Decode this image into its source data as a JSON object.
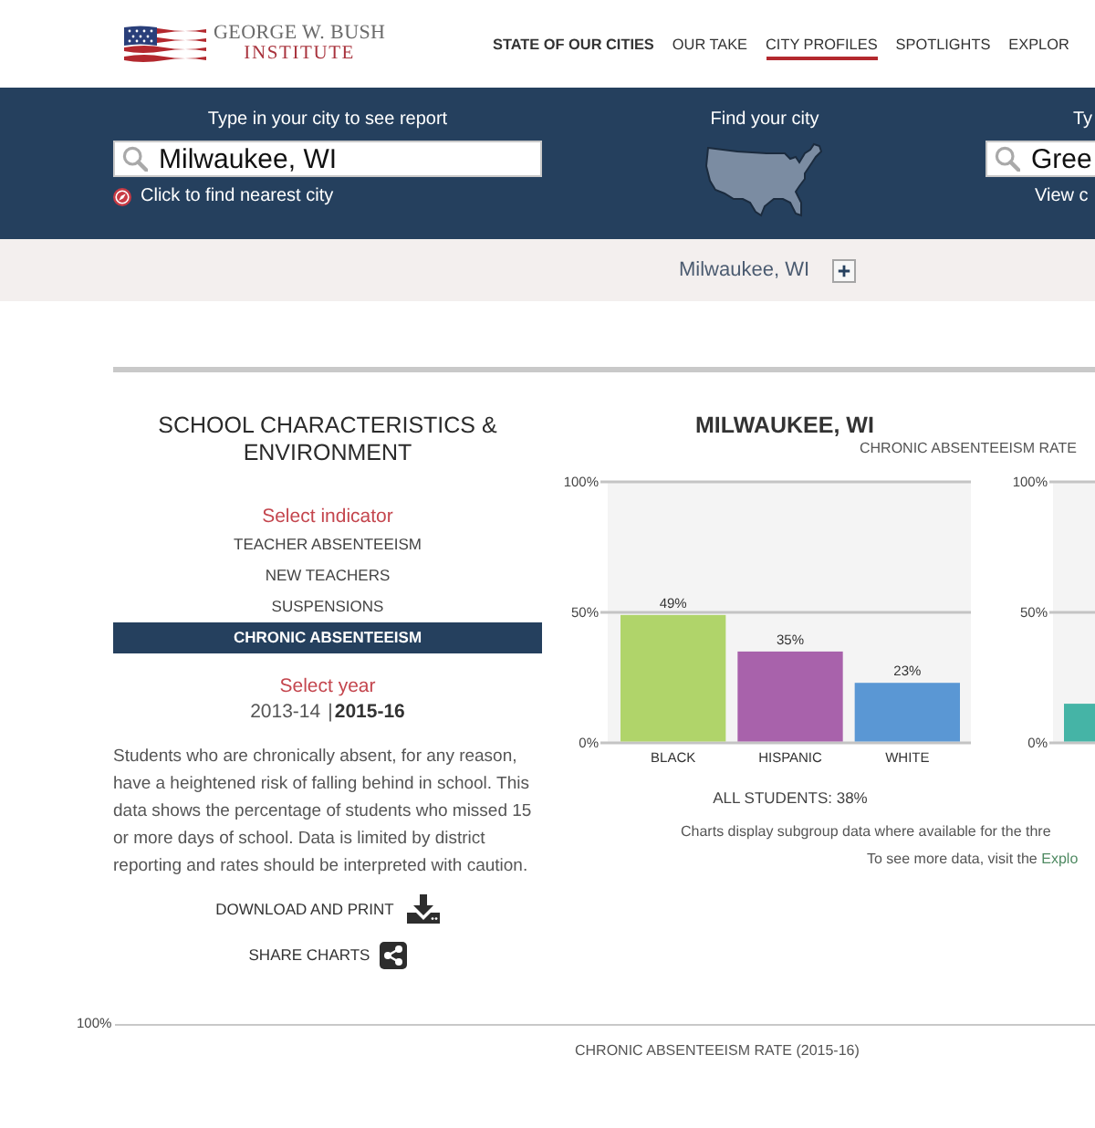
{
  "header": {
    "logo": {
      "line_1": "GEORGE W. BUSH",
      "line_2": "INSTITUTE"
    },
    "nav": [
      {
        "label": "STATE OF OUR CITIES",
        "kind": "title",
        "selected": false
      },
      {
        "label": "OUR TAKE",
        "kind": "link",
        "selected": false
      },
      {
        "label": "CITY PROFILES",
        "kind": "link",
        "selected": true
      },
      {
        "label": "SPOTLIGHTS",
        "kind": "link",
        "selected": false
      },
      {
        "label": "EXPLOR",
        "kind": "link",
        "selected": false
      }
    ]
  },
  "search_band": {
    "city_search": {
      "label": "Type in your city to see report",
      "value": "Milwaukee, WI",
      "link": "Click to find nearest city"
    },
    "map_finder": {
      "label": "Find your city"
    },
    "compare_search": {
      "label": "Ty",
      "value": "Gree",
      "link": "View c"
    }
  },
  "city_bar": {
    "city": "Milwaukee, WI"
  },
  "panel": {
    "title": "SCHOOL CHARACTERISTICS & ENVIRONMENT",
    "indicator_label": "Select indicator",
    "indicators": [
      {
        "label": "TEACHER ABSENTEEISM",
        "selected": false
      },
      {
        "label": "NEW TEACHERS",
        "selected": false
      },
      {
        "label": "SUSPENSIONS",
        "selected": false
      },
      {
        "label": "CHRONIC ABSENTEEISM",
        "selected": true
      }
    ],
    "year_label": "Select year",
    "years": [
      {
        "label": "2013-14",
        "selected": false
      },
      {
        "label": "2015-16",
        "selected": true
      }
    ],
    "year_separator": "|",
    "description": "Students who are chronically absent, for any reason, have a heightened risk of falling behind in school. This data shows the percentage of students who missed 15 or more days of school. Data is limited by district reporting and rates should be interpreted with caution.",
    "actions": [
      {
        "label": "DOWNLOAD AND PRINT",
        "kind": "download"
      },
      {
        "label": "SHARE CHARTS",
        "kind": "share"
      }
    ]
  },
  "results": {
    "city": "MILWAUKEE, WI",
    "subtitle": "CHRONIC ABSENTEEISM RATE",
    "charts": [
      {
        "chart_data": {
          "type": "bar",
          "categories": [
            "BLACK",
            "HISPANIC",
            "WHITE"
          ],
          "values": [
            49,
            35,
            23
          ],
          "colors": [
            "#b0d46a",
            "#a862ab",
            "#5a97d4"
          ],
          "value_labels": [
            "49%",
            "35%",
            "23%"
          ],
          "ylim": [
            0,
            100
          ],
          "yticks": [
            {
              "value": 0,
              "label": "0%"
            },
            {
              "value": 50,
              "label": "50%"
            },
            {
              "value": 100,
              "label": "100%"
            }
          ]
        },
        "summary": "ALL STUDENTS: 38%"
      },
      {
        "chart_data": {
          "type": "bar",
          "values": [
            15
          ],
          "colors": [
            "#45b4a6"
          ],
          "ylim": [
            0,
            100
          ],
          "yticks": [
            {
              "value": 0,
              "label": "0%"
            },
            {
              "value": 50,
              "label": "50%"
            },
            {
              "value": 100,
              "label": "100%"
            }
          ]
        }
      }
    ],
    "note": "Charts display subgroup data where available for the thre",
    "more": {
      "text": "To see more data, visit the",
      "link": "Explo"
    }
  },
  "bottom_chart": {
    "tick": "100%",
    "title": "CHRONIC ABSENTEEISM RATE (2015-16)"
  }
}
